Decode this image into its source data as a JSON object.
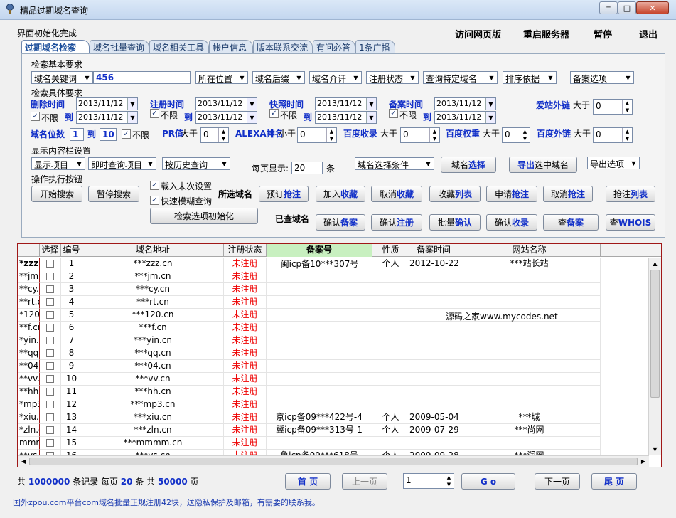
{
  "window": {
    "title": "精品过期域名查询",
    "min": "─",
    "max": "□",
    "close": "✕"
  },
  "status": "界面初始化完成",
  "top_commands": [
    "访问网页版",
    "重启服务器",
    "暂停",
    "退出"
  ],
  "tabs": [
    "过期域名检索",
    "域名批量查询",
    "域名相关工具",
    "帐户信息",
    "版本联系交流",
    "有问必答",
    "1条广播"
  ],
  "search": {
    "basic_label": "检索基本要求",
    "keyword_type": "域名关键词",
    "keyword_value": "456",
    "position": "所在位置",
    "suffix": "域名后缀",
    "intro": "域名介讦",
    "reg_status": "注册状态",
    "query_specific": "查询特定域名",
    "sort": "排序依据",
    "beian_opt": "备案选项",
    "detail_label": "检索具体要求",
    "dates": [
      {
        "label": "删除时间",
        "from": "2013/11/12",
        "to": "2013/11/12"
      },
      {
        "label": "注册时间",
        "from": "2013/11/12",
        "to": "2013/11/12"
      },
      {
        "label": "快照时间",
        "from": "2013/11/12",
        "to": "2013/11/12"
      },
      {
        "label": "备案时间",
        "from": "2013/11/12",
        "to": "2013/11/12"
      }
    ],
    "unlimited": "不限",
    "to": "到",
    "love_links": "爱站外链",
    "greater": "大于",
    "less": "小于",
    "love_value": "0",
    "digits_label": "域名位数",
    "digits_from": "1",
    "digits_to": "10",
    "pr_label": "PR值",
    "pr_value": "0",
    "alexa_label": "ALEXA排名",
    "alexa_value": "0",
    "bd_index_label": "百度收录",
    "bd_index_value": "0",
    "bd_weight_label": "百度权重",
    "bd_weight_value": "0",
    "bd_links_label": "百度外链",
    "bd_links_value": "0",
    "display_label": "显示内容栏设置",
    "display_items": "显示项目",
    "instant_items": "即时查询项目",
    "history": "按历史查询",
    "per_page_label": "每页显示:",
    "per_page_value": "20",
    "per_page_unit": "条",
    "domain_cond": "域名选择条件",
    "export_opt": "导出选项",
    "ops_label": "操作执行按钮",
    "load_last": "载入未次设置",
    "fuzzy": "快速模糊查询",
    "selected_label": "所选域名",
    "checked_label": "已查域名"
  },
  "buttons": {
    "domain_select_a": "域名",
    "domain_select_b": "选择",
    "export_a": "导出",
    "export_b": " 选中域名",
    "start": "开始搜索",
    "pause": "暂停搜索",
    "reset": "检索选项初始化",
    "row1": [
      [
        "预订",
        "抢注"
      ],
      [
        "加入",
        "收藏"
      ],
      [
        "取消",
        "收藏"
      ],
      [
        "收藏",
        "列表"
      ],
      [
        "申请",
        "抢注"
      ],
      [
        "取消",
        "抢注"
      ],
      [
        "抢注",
        "列表"
      ]
    ],
    "row2": [
      [
        "确认",
        "备案"
      ],
      [
        "确认",
        "注册"
      ],
      [
        "批量",
        "确认"
      ],
      [
        "确认",
        "收录"
      ],
      [
        "查",
        "备案"
      ],
      [
        "查",
        "WHOIS"
      ]
    ]
  },
  "table": {
    "headers": [
      "选择",
      "编号",
      "域名地址",
      "注册状态",
      "备案号",
      "性质",
      "备案时间",
      "网站名称"
    ],
    "rows": [
      {
        "pre": "*zzz.",
        "no": "1",
        "domain": "***zzz.cn",
        "status": "未注册",
        "beian": "闽icp备10***307号",
        "nature": "个人",
        "date": "2012-10-22",
        "site": "***站长站"
      },
      {
        "pre": "**jm.c",
        "no": "2",
        "domain": "***jm.cn",
        "status": "未注册",
        "beian": "",
        "nature": "",
        "date": "",
        "site": ""
      },
      {
        "pre": "**cy.c",
        "no": "3",
        "domain": "***cy.cn",
        "status": "未注册",
        "beian": "",
        "nature": "",
        "date": "",
        "site": ""
      },
      {
        "pre": "**rt.cn",
        "no": "4",
        "domain": "***rt.cn",
        "status": "未注册",
        "beian": "",
        "nature": "",
        "date": "",
        "site": ""
      },
      {
        "pre": "*120.",
        "no": "5",
        "domain": "***120.cn",
        "status": "未注册",
        "beian": "",
        "nature": "",
        "date": "",
        "site": ""
      },
      {
        "pre": "**f.cn",
        "no": "6",
        "domain": "***f.cn",
        "status": "未注册",
        "beian": "",
        "nature": "",
        "date": "",
        "site": ""
      },
      {
        "pre": "*yin.c",
        "no": "7",
        "domain": "***yin.cn",
        "status": "未注册",
        "beian": "",
        "nature": "",
        "date": "",
        "site": ""
      },
      {
        "pre": "**qq.c",
        "no": "8",
        "domain": "***qq.cn",
        "status": "未注册",
        "beian": "",
        "nature": "",
        "date": "",
        "site": ""
      },
      {
        "pre": "**04.c",
        "no": "9",
        "domain": "***04.cn",
        "status": "未注册",
        "beian": "",
        "nature": "",
        "date": "",
        "site": ""
      },
      {
        "pre": "**vv.c",
        "no": "10",
        "domain": "***vv.cn",
        "status": "未注册",
        "beian": "",
        "nature": "",
        "date": "",
        "site": ""
      },
      {
        "pre": "**hh.c",
        "no": "11",
        "domain": "***hh.cn",
        "status": "未注册",
        "beian": "",
        "nature": "",
        "date": "",
        "site": ""
      },
      {
        "pre": "*mp3.",
        "no": "12",
        "domain": "***mp3.cn",
        "status": "未注册",
        "beian": "",
        "nature": "",
        "date": "",
        "site": ""
      },
      {
        "pre": "*xiu.c",
        "no": "13",
        "domain": "***xiu.cn",
        "status": "未注册",
        "beian": "京icp备09***422号-4",
        "nature": "个人",
        "date": "2009-05-04",
        "site": "***城"
      },
      {
        "pre": "*zln.c",
        "no": "14",
        "domain": "***zln.cn",
        "status": "未注册",
        "beian": "冀icp备09***313号-1",
        "nature": "个人",
        "date": "2009-07-29",
        "site": "***尚网"
      },
      {
        "pre": "mmmm",
        "no": "15",
        "domain": "***mmmm.cn",
        "status": "未注册",
        "beian": "",
        "nature": "",
        "date": "",
        "site": ""
      },
      {
        "pre": "**ys.c",
        "no": "16",
        "domain": "***ys.cn",
        "status": "未注册",
        "beian": "鲁icp备09***618号",
        "nature": "个人",
        "date": "2009-09-28",
        "site": "***润网"
      }
    ],
    "watermark": "源码之家www.mycodes.net"
  },
  "pager": {
    "total_prefix": "共",
    "total": "1000000",
    "total_suffix": "条记录 每页",
    "per_page": "20",
    "mid": "条 共",
    "pages": "50000",
    "pages_suffix": "页",
    "first": "首 页",
    "prev": "上一页",
    "page_input": "1",
    "go": "G o",
    "next": "下一页",
    "last": "尾 页"
  },
  "footnote": "国外zpou.com平台com域名批量正规注册42块，送隐私保护及邮箱，有需要的联系我。",
  "colors": {
    "accent_blue": "#1230c8",
    "red": "#e00000",
    "beian_header_bg": "#c8f0c0"
  }
}
